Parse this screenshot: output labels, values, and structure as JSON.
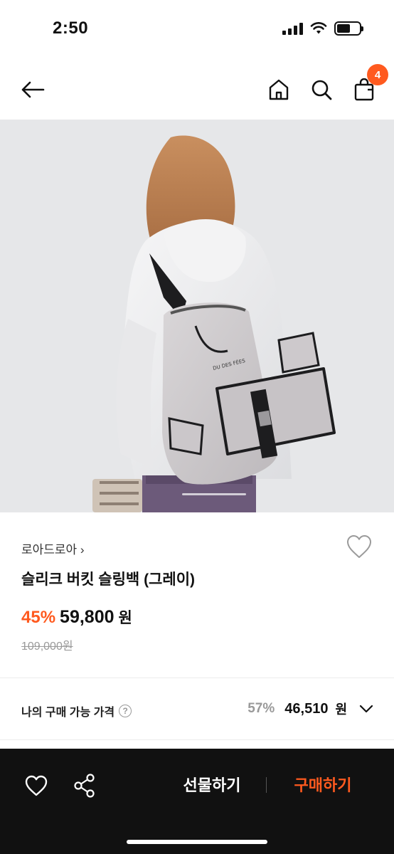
{
  "status_bar": {
    "time": "2:50"
  },
  "nav": {
    "cart_count": "4"
  },
  "product": {
    "brand": "로아드로아 ›",
    "title": "슬리크 버킷 슬링백 (그레이)",
    "discount": "45%",
    "price": "59,800",
    "price_unit": "원",
    "original_price": "109,000원",
    "bag_logo_text": "DU DES FÉES"
  },
  "buyable": {
    "label": "나의 구매 가능 가격",
    "help": "?",
    "discount": "57%",
    "price": "46,510",
    "unit": "원"
  },
  "bottom_bar": {
    "gift_label": "선물하기",
    "buy_label": "구매하기"
  },
  "colors": {
    "accent": "#ff5a1f",
    "bottom_bar_bg": "#111111"
  },
  "icons": [
    "back-arrow-icon",
    "home-icon",
    "search-icon",
    "cart-icon",
    "heart-icon",
    "share-icon",
    "help-icon",
    "chevron-down-icon"
  ]
}
